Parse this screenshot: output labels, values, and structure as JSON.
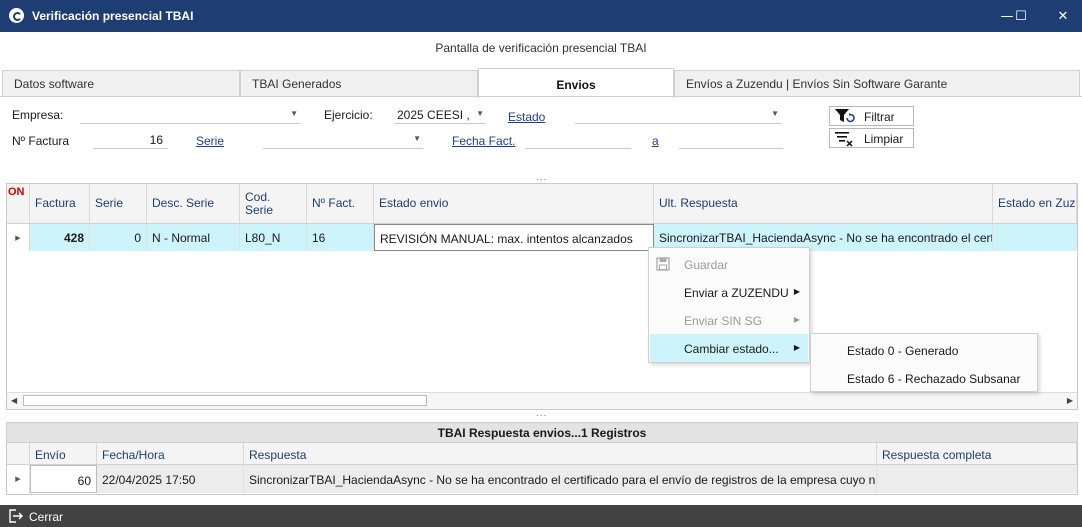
{
  "window": {
    "title": "Verificación presencial TBAI",
    "minimize": "—",
    "maximize": "☐",
    "close": "✕"
  },
  "header": {
    "title": "Pantalla de verificación presencial TBAI"
  },
  "tabs": [
    {
      "label": "Datos software"
    },
    {
      "label": "TBAI Generados"
    },
    {
      "label": "Envios"
    },
    {
      "label": "Envíos a Zuzendu | Envíos Sin Software Garante"
    }
  ],
  "filters": {
    "empresa_label": "Empresa:",
    "empresa_value": "",
    "ejercicio_label": "Ejercicio:",
    "ejercicio_value": "2025 CEESI ,",
    "estado_label": "Estado",
    "estado_value": "",
    "nfactura_label": "Nº Factura",
    "nfactura_value": "16",
    "serie_label": "Serie",
    "serie_value": "",
    "fecha_label": "Fecha Fact.",
    "fecha_from": "",
    "a_label": "a",
    "fecha_to": "",
    "filtrar_label": "Filtrar",
    "limpiar_label": "Limpiar"
  },
  "grid": {
    "on_label": "ON",
    "columns": [
      "Factura",
      "Serie",
      "Desc. Serie",
      "Cod. Serie",
      "Nº Fact.",
      "Estado envio",
      "Ult. Respuesta",
      "Estado en Zuze"
    ],
    "rows": [
      {
        "factura": "428",
        "serie": "0",
        "desc_serie": "N - Normal",
        "cod_serie": "L80_N",
        "nfact": "16",
        "estado_envio": "REVISIÓN MANUAL: max. intentos alcanzados",
        "ult_respuesta": "SincronizarTBAI_HaciendaAsync - No se ha encontrado el certi...",
        "estado_zuzendu": ""
      }
    ]
  },
  "context_menu": {
    "items": [
      {
        "label": "Guardar",
        "enabled": false,
        "icon": "save-icon"
      },
      {
        "label": "Enviar a ZUZENDU",
        "enabled": true,
        "submenu": true
      },
      {
        "label": "Enviar SIN SG",
        "enabled": false,
        "submenu": true
      },
      {
        "label": "Cambiar estado...",
        "enabled": true,
        "submenu": true,
        "highlighted": true
      }
    ],
    "submenu": [
      {
        "label": "Estado 0 - Generado"
      },
      {
        "label": "Estado 6 - Rechazado Subsanar"
      }
    ]
  },
  "response_panel": {
    "title": "TBAI Respuesta envios...1 Registros",
    "columns": [
      "Envío",
      "Fecha/Hora",
      "Respuesta",
      "Respuesta completa"
    ],
    "rows": [
      {
        "envio": "60",
        "fecha": "22/04/2025 17:50",
        "respuesta": "SincronizarTBAI_HaciendaAsync - No se ha encontrado el certificado para el envío de registros de la empresa cuyo nif ...",
        "respuesta_completa": ""
      }
    ]
  },
  "footer": {
    "close_label": "Cerrar"
  },
  "splitter": "...",
  "colors": {
    "titlebar": "#1e3d73",
    "selected_row": "#cdf3fb",
    "footer": "#424242",
    "on_label": "#d00000"
  }
}
